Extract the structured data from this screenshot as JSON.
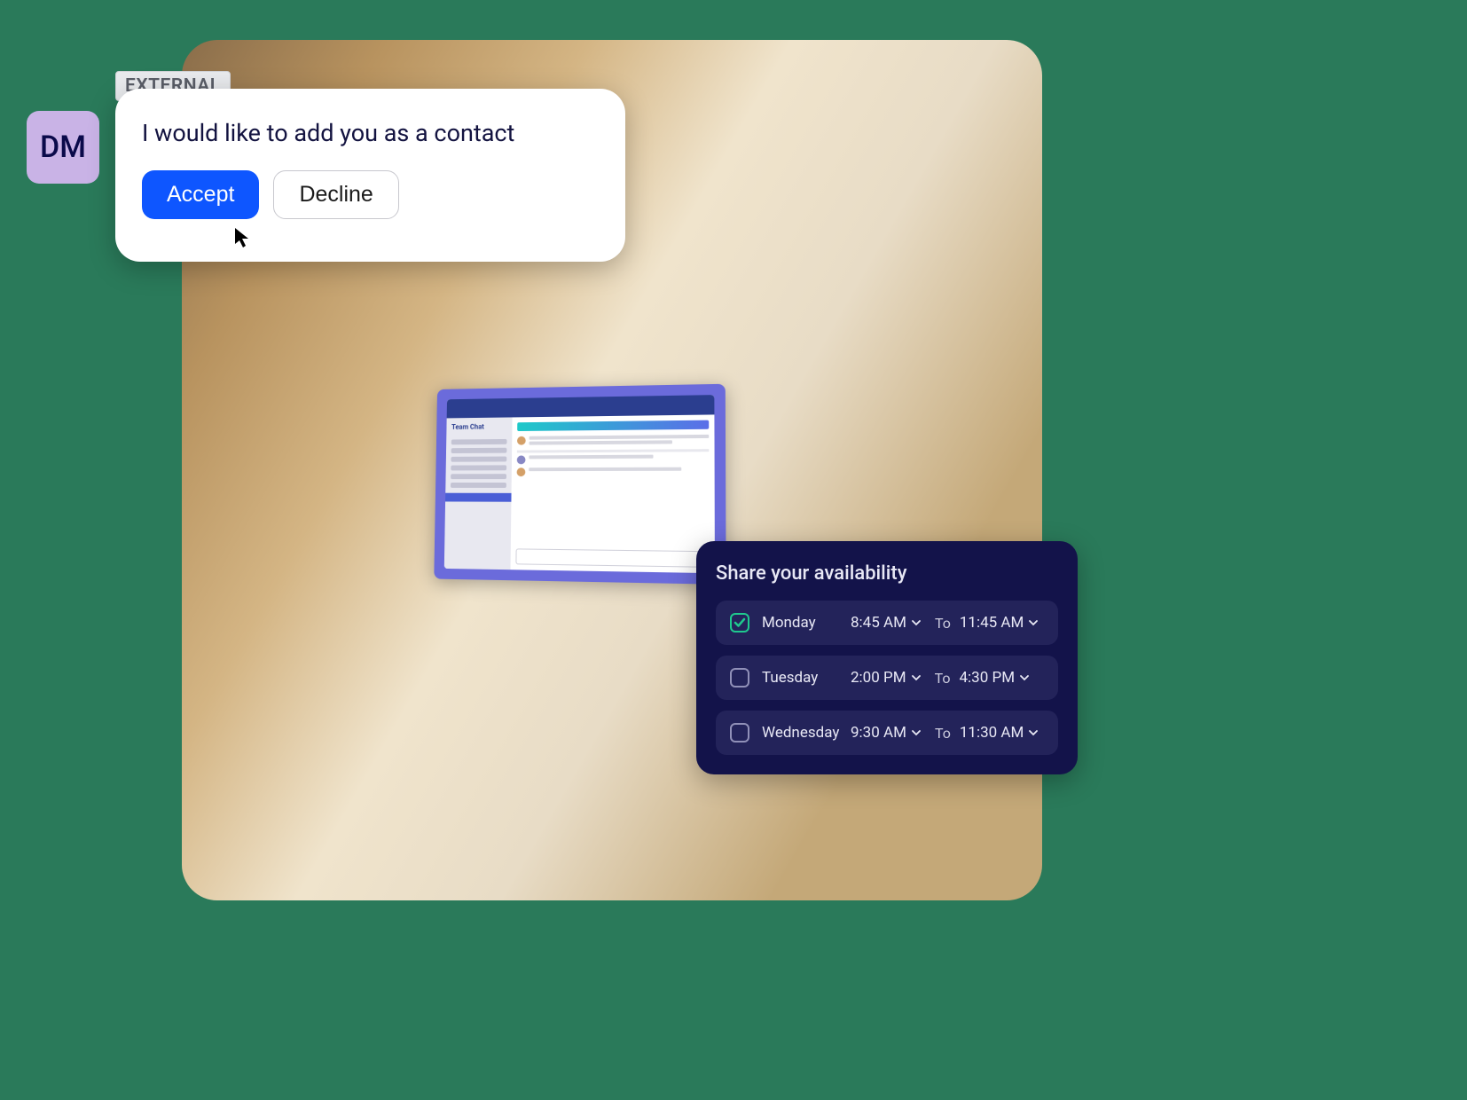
{
  "contact_request": {
    "avatar_initials": "DM",
    "external_badge": "EXTERNAL",
    "message": "I would like to add you as a contact",
    "accept_label": "Accept",
    "decline_label": "Decline"
  },
  "laptop": {
    "app_title": "Team Chat"
  },
  "availability": {
    "title": "Share your availability",
    "to_label": "To",
    "days": [
      {
        "name": "Monday",
        "checked": true,
        "start": "8:45 AM",
        "end": "11:45 AM"
      },
      {
        "name": "Tuesday",
        "checked": false,
        "start": "2:00 PM",
        "end": "4:30 PM"
      },
      {
        "name": "Wednesday",
        "checked": false,
        "start": "9:30 AM",
        "end": "11:30 AM"
      }
    ]
  }
}
